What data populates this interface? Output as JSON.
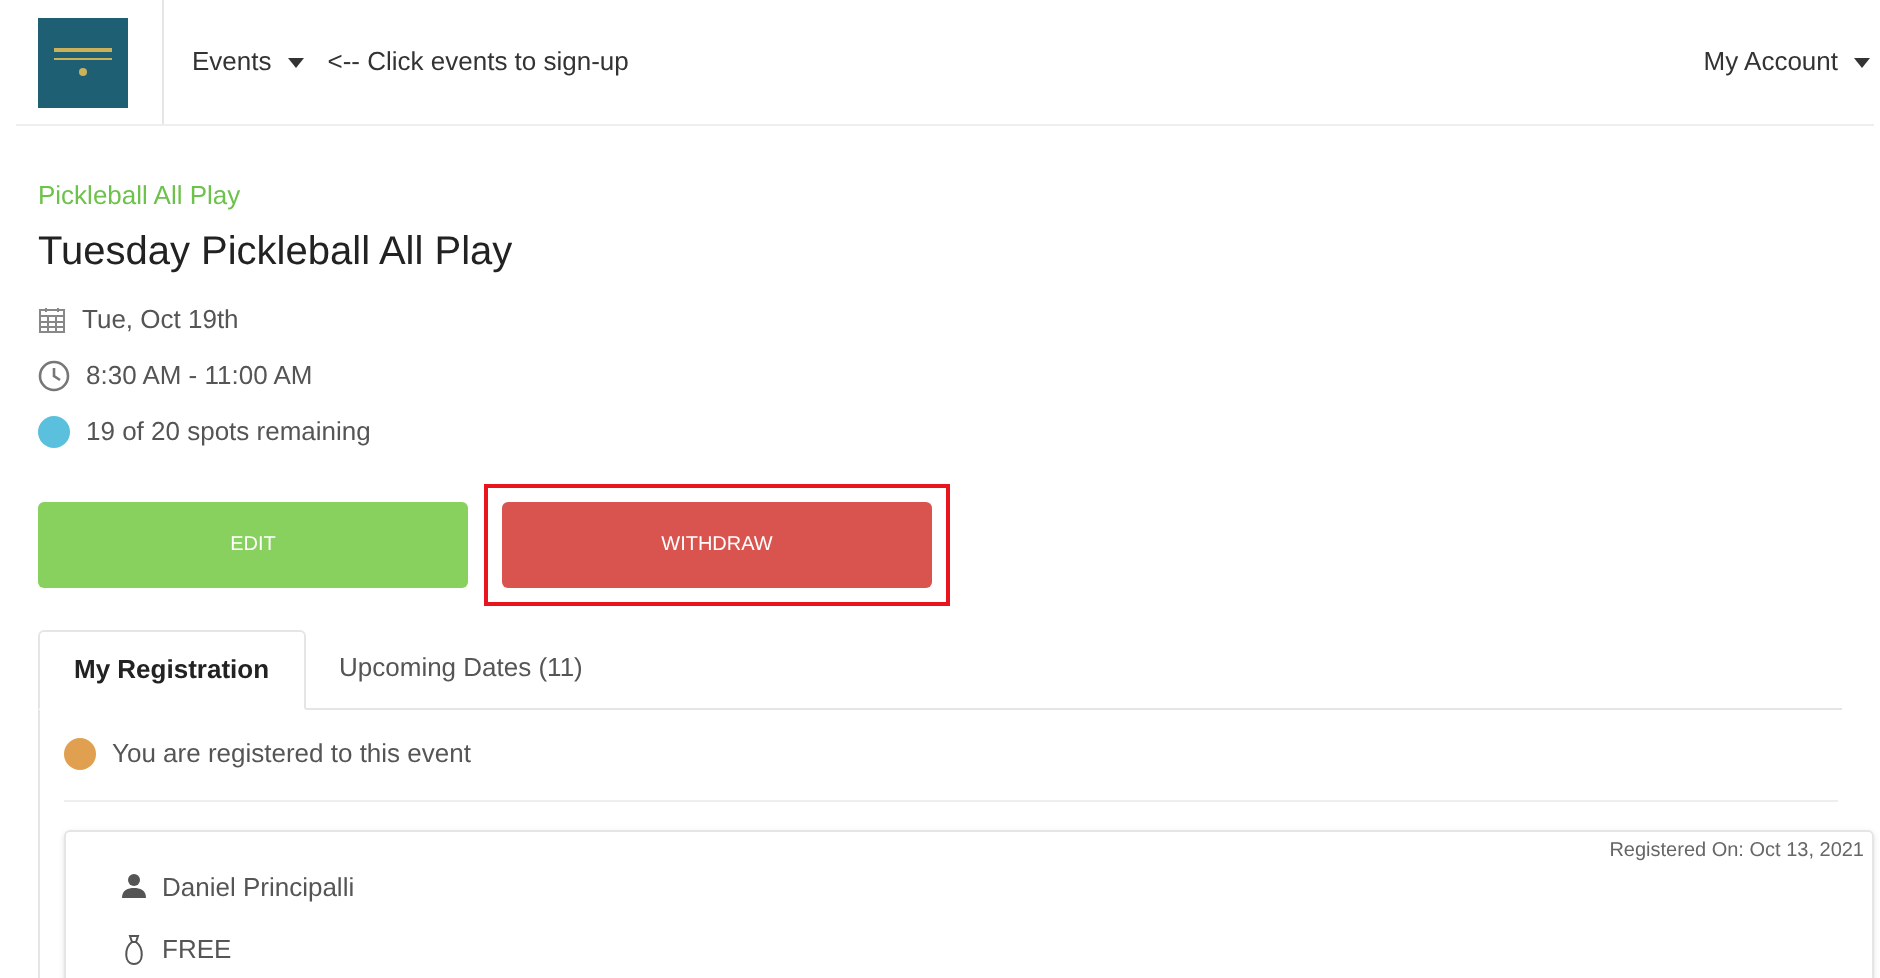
{
  "nav": {
    "menu": "Events",
    "hint": "<-- Click events to sign-up",
    "account": "My Account"
  },
  "event": {
    "category": "Pickleball All Play",
    "title": "Tuesday Pickleball All Play",
    "date": "Tue, Oct 19th",
    "time": "8:30 AM - 11:00 AM",
    "spots": {
      "text": "19 of 20 spots remaining",
      "color": "#5bc0de"
    }
  },
  "buttons": [
    {
      "label": "EDIT",
      "kind": "edit",
      "highlighted": false
    },
    {
      "label": "WITHDRAW",
      "kind": "withdraw",
      "highlighted": true
    }
  ],
  "tabs": [
    {
      "label": "My Registration",
      "selected": true
    },
    {
      "label": "Upcoming Dates (11)",
      "selected": false
    }
  ],
  "registration": {
    "status": {
      "text": "You are registered to this event",
      "color": "#e0a050"
    },
    "registered_on": "Registered On: Oct 13, 2021",
    "name": "Daniel Principalli",
    "price": "FREE"
  }
}
